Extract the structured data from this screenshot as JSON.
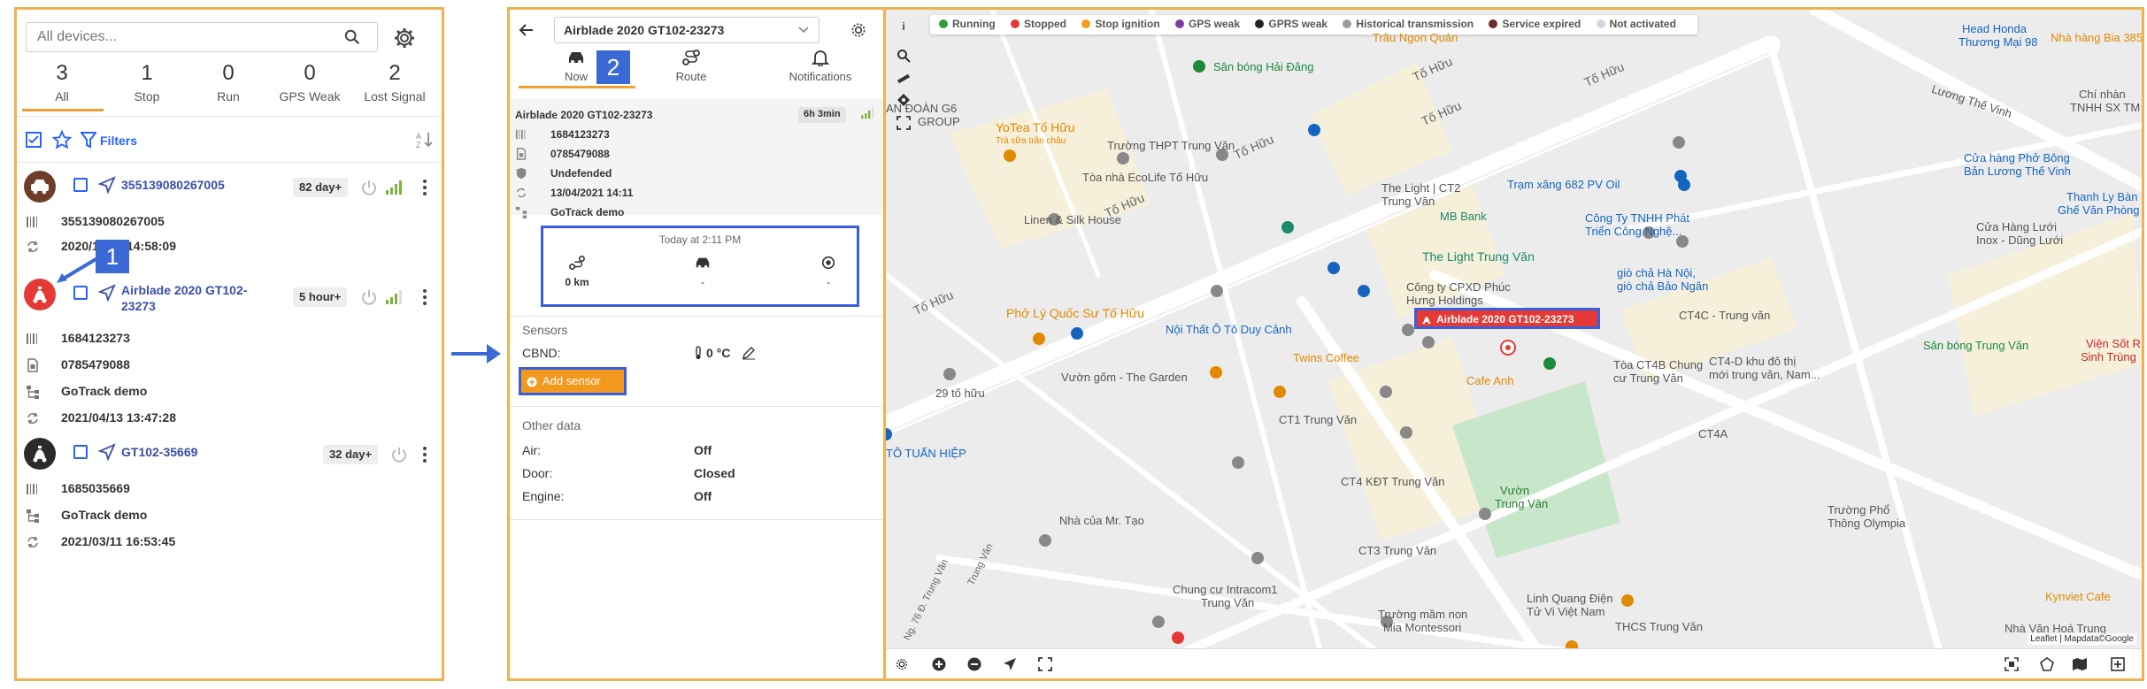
{
  "left": {
    "search_placeholder": "All devices...",
    "stats": [
      {
        "count": "3",
        "label": "All"
      },
      {
        "count": "1",
        "label": "Stop"
      },
      {
        "count": "0",
        "label": "Run"
      },
      {
        "count": "0",
        "label": "GPS Weak"
      },
      {
        "count": "2",
        "label": "Lost Signal"
      }
    ],
    "filters_label": "Filters",
    "devices": [
      {
        "name": "355139080267005",
        "badge": "82 day+",
        "status_color": "#6d3d2a",
        "rows": [
          "355139080267005",
          "2020/10/03 14:58:09"
        ]
      },
      {
        "name": "Airblade 2020 GT102-23273",
        "badge": "5 hour+",
        "status_color": "#e53935",
        "rows": [
          "1684123273",
          "0785479088",
          "GoTrack demo",
          "2021/04/13 13:47:28"
        ]
      },
      {
        "name": "GT102-35669",
        "badge": "32 day+",
        "status_color": "#2b2b2b",
        "rows": [
          "1685035669",
          "GoTrack demo",
          "2021/03/11 16:53:45"
        ]
      }
    ]
  },
  "callouts": [
    "1",
    "2"
  ],
  "mid": {
    "device_select": "Airblade 2020 GT102-23273",
    "tabs": [
      "Now",
      "Route",
      "Notifications"
    ],
    "info": {
      "title": "Airblade 2020 GT102-23273",
      "duration": "6h 3min",
      "rows": [
        "1684123273",
        "0785479088",
        "Undefended",
        "13/04/2021 14:11",
        "GoTrack demo"
      ]
    },
    "summary": {
      "time": "Today at 2:11 PM",
      "distance": "0 km",
      "speed": "-",
      "status": "-"
    },
    "sensors_title": "Sensors",
    "sensor_name": "CBND:",
    "sensor_value": "0 °C",
    "add_sensor": "Add sensor",
    "other_title": "Other data",
    "other": [
      {
        "k": "Air:",
        "v": "Off"
      },
      {
        "k": "Door:",
        "v": "Closed"
      },
      {
        "k": "Engine:",
        "v": "Off"
      }
    ]
  },
  "map": {
    "legend": [
      {
        "label": "Running",
        "color": "#2e9d3a"
      },
      {
        "label": "Stopped",
        "color": "#e53935"
      },
      {
        "label": "Stop ignition",
        "color": "#f59c1a"
      },
      {
        "label": "GPS weak",
        "color": "#7b3fa0"
      },
      {
        "label": "GPRS weak",
        "color": "#222222"
      },
      {
        "label": "Historical transmission",
        "color": "#9e9e9e"
      },
      {
        "label": "Service expired",
        "color": "#6d2a2a"
      },
      {
        "label": "Not activated",
        "color": "#d6d6e6"
      }
    ],
    "marker_label": "Airblade 2020 GT102-23273",
    "attribution": "Leaflet | Mapdata©Google",
    "places": [
      {
        "t": "Sân bóng Hải Đăng",
        "c": "#1b8a3a"
      },
      {
        "t": "YoTea Tố Hữu",
        "c": "#e08a00"
      },
      {
        "t": "Trà sữa trân châu",
        "c": "#e08a00"
      },
      {
        "t": "Trường THPT Trung Văn",
        "c": "#555"
      },
      {
        "t": "Tòa nhà EcoLife Tố Hữu",
        "c": "#555"
      },
      {
        "t": "Linen & Silk House",
        "c": "#555"
      },
      {
        "t": "The Light | CT2",
        "c": "#555"
      },
      {
        "t": "Trung Văn",
        "c": "#555"
      },
      {
        "t": "MB Bank",
        "c": "#1b8a6a"
      },
      {
        "t": "The Light Trung Văn",
        "c": "#1b8a6a"
      },
      {
        "t": "Trạm xăng 682 PV Oil",
        "c": "#1565c0"
      },
      {
        "t": "Công Ty TNHH Phát",
        "c": "#1565c0"
      },
      {
        "t": "Triển Công Nghệ...",
        "c": "#1565c0"
      },
      {
        "t": "Công ty CPXD Phúc",
        "c": "#555"
      },
      {
        "t": "Hưng Holdings",
        "c": "#555"
      },
      {
        "t": "giò chả Hà Nội,",
        "c": "#1565c0"
      },
      {
        "t": "giò chả Bảo Ngân",
        "c": "#1565c0"
      },
      {
        "t": "Phở Lý Quốc Sư Tố Hữu",
        "c": "#e08a00"
      },
      {
        "t": "Nội Thất Ô Tô Duy Cảnh",
        "c": "#1565c0"
      },
      {
        "t": "Twins Coffee",
        "c": "#e08a00"
      },
      {
        "t": "Cafe Anh",
        "c": "#e08a00"
      },
      {
        "t": "CT4C - Trung văn",
        "c": "#555"
      },
      {
        "t": "Sân bóng Trung Văn",
        "c": "#1b8a3a"
      },
      {
        "t": "Tòa CT4B Chung",
        "c": "#555"
      },
      {
        "t": "cư Trung Văn",
        "c": "#555"
      },
      {
        "t": "CT4-D khu đô thị",
        "c": "#555"
      },
      {
        "t": "mới trung văn, Nam...",
        "c": "#555"
      },
      {
        "t": "Vườn gốm - The Garden",
        "c": "#555"
      },
      {
        "t": "29 tố hữu",
        "c": "#555"
      },
      {
        "t": "CT1 Trung Văn",
        "c": "#555"
      },
      {
        "t": "CT4A",
        "c": "#555"
      },
      {
        "t": "TÔ TUẤN HIỆP",
        "c": "#1565c0"
      },
      {
        "t": "CT4 KĐT Trung Văn",
        "c": "#555"
      },
      {
        "t": "Vườn",
        "c": "#2e7d32"
      },
      {
        "t": "Trung Văn",
        "c": "#2e7d32"
      },
      {
        "t": "Nhà của Mr. Tạo",
        "c": "#555"
      },
      {
        "t": "CT3 Trung Văn",
        "c": "#555"
      },
      {
        "t": "Chung cư Intracom1",
        "c": "#555"
      },
      {
        "t": "Trung Văn",
        "c": "#555"
      },
      {
        "t": "Trường mầm non",
        "c": "#555"
      },
      {
        "t": "Mia Montessori",
        "c": "#555"
      },
      {
        "t": "Linh Quang Điện",
        "c": "#555"
      },
      {
        "t": "Tử Vi Việt Nam",
        "c": "#555"
      },
      {
        "t": "THCS Trung Văn",
        "c": "#555"
      },
      {
        "t": "Trường Phổ",
        "c": "#555"
      },
      {
        "t": "Thông Olympia",
        "c": "#555"
      },
      {
        "t": "Nhà Văn Hoá Trung",
        "c": "#555"
      },
      {
        "t": "Kynviet Cafe",
        "c": "#e08a00"
      },
      {
        "t": "Head Honda",
        "c": "#1565c0"
      },
      {
        "t": "Thương Mại 98",
        "c": "#1565c0"
      },
      {
        "t": "Nhà hàng Bia 385",
        "c": "#e08a00"
      },
      {
        "t": "Lương Thế Vinh",
        "c": "#555"
      },
      {
        "t": "Cửa hàng Phở Bông",
        "c": "#1565c0"
      },
      {
        "t": "Bản Lương Thế Vinh",
        "c": "#1565c0"
      },
      {
        "t": "Thanh Ly Bàn",
        "c": "#1565c0"
      },
      {
        "t": "Ghế Văn Phòng",
        "c": "#1565c0"
      },
      {
        "t": "Cửa Hàng Lưới",
        "c": "#555"
      },
      {
        "t": "Inox - Dũng Lưới",
        "c": "#555"
      },
      {
        "t": "Chí nhàn",
        "c": "#555"
      },
      {
        "t": "TNHH SX TM",
        "c": "#555"
      },
      {
        "t": "Viện Sốt R",
        "c": "#c62828"
      },
      {
        "t": "Sinh Trùng",
        "c": "#c62828"
      },
      {
        "t": "Tố Hữu",
        "c": "#666"
      },
      {
        "t": "Tố Hữu",
        "c": "#666"
      },
      {
        "t": "Tố Hữu",
        "c": "#666"
      },
      {
        "t": "Tố Hữu",
        "c": "#666"
      },
      {
        "t": "Tố Hữu",
        "c": "#666"
      },
      {
        "t": "Tố Hữu",
        "c": "#666"
      },
      {
        "t": "AN ĐOÀN G6",
        "c": "#555"
      },
      {
        "t": "GROUP",
        "c": "#555"
      },
      {
        "t": "Trâu Ngon Quán",
        "c": "#e08a00"
      },
      {
        "t": "Ng. 76 Đ. Trung Văn",
        "c": "#666"
      },
      {
        "t": "Trung Văn",
        "c": "#666"
      }
    ]
  }
}
